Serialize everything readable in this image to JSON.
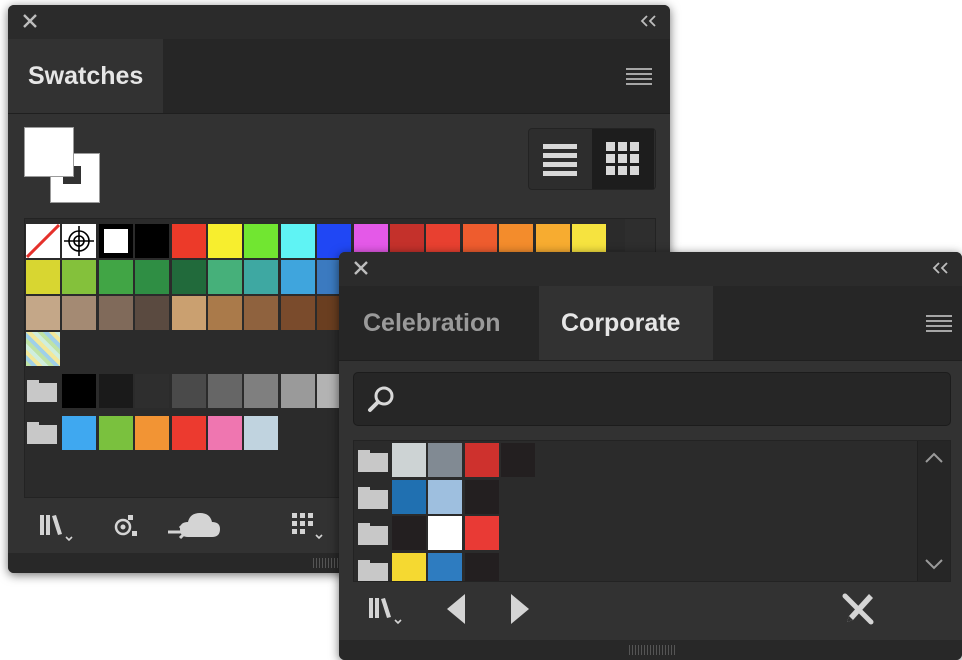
{
  "swatches_panel": {
    "tab_label": "Swatches",
    "icons": {
      "close": "close-icon",
      "collapse": "collapse-icon",
      "menu": "panel-menu-icon",
      "list_view": "list-view-icon",
      "grid_view": "grid-view-icon",
      "library": "swatch-libraries-icon",
      "show_kinds": "show-swatch-kinds-icon",
      "add_to_library": "add-to-library-icon",
      "swatch_options": "swatch-options-icon"
    },
    "rows": [
      [
        "special-none",
        "special-registration",
        "special-white-frame",
        "#000000",
        "#ec3a29",
        "#f7ee2e",
        "#71e631",
        "#5ff3f4",
        "#2047f4",
        "#e459e8",
        "#c4312b",
        "#e84030",
        "#ee5c2e",
        "#f38c2c",
        "#f7ac30",
        "#f6e33f"
      ],
      [
        "#d8d631",
        "#84c13b",
        "#41a545",
        "#2f8e44",
        "#216a3b",
        "#46b07a",
        "#3ea8a2",
        "#3fa5dd",
        "#3b7ac0"
      ],
      [
        "#c4a788",
        "#a48a73",
        "#806a5a",
        "#5a4a40",
        "#caa070",
        "#aa7a4a",
        "#8f623e",
        "#7a4b2c",
        "#6a3e20"
      ],
      [
        "pattern"
      ],
      [
        "folder",
        "#000000",
        "#1a1a1a",
        "#2e2e2e",
        "#4a4a4a",
        "#666666",
        "#7f7f7f",
        "#9a9a9a",
        "#b3b3b3"
      ],
      [
        "folder",
        "#3fa8f0",
        "#7ac13e",
        "#f29434",
        "#ec3a2f",
        "#ef76b0",
        "#c0d3df"
      ]
    ]
  },
  "library_panel": {
    "tabs": [
      {
        "label": "Celebration",
        "active": false
      },
      {
        "label": "Corporate",
        "active": true
      }
    ],
    "search_placeholder": "",
    "groups": [
      [
        "#cdd3d4",
        "#818a93",
        "#ce312d",
        "#231f20"
      ],
      [
        "#2070b1",
        "#9ebfdf",
        "#231f20"
      ],
      [
        "#231f20",
        "#ffffff",
        "#e93a35"
      ],
      [
        "#f5d931",
        "#2e7cc0",
        "#231f20"
      ]
    ],
    "icons": {
      "close": "close-icon",
      "collapse": "collapse-icon",
      "menu": "panel-menu-icon",
      "search": "search-icon",
      "scroll_up": "chevron-up-icon",
      "scroll_down": "chevron-down-icon",
      "library": "swatch-libraries-icon",
      "prev": "previous-library-icon",
      "next": "next-library-icon",
      "edit": "edit-swatches-icon"
    }
  }
}
